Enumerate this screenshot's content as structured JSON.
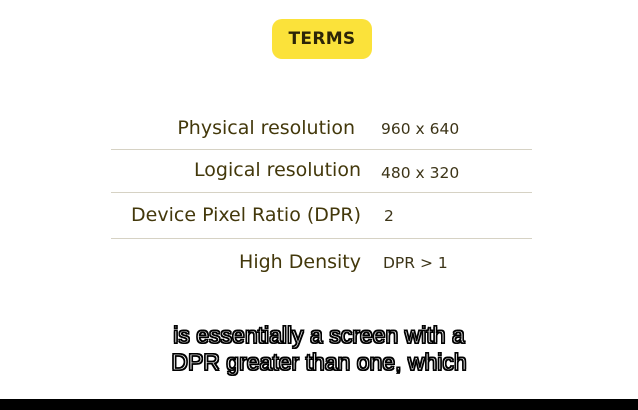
{
  "badge": {
    "label": "TERMS"
  },
  "terms": [
    {
      "term": "Physical resolution",
      "definition": "960 x 640"
    },
    {
      "term": "Logical resolution",
      "definition": "480 x 320"
    },
    {
      "term": "Device Pixel Ratio (DPR)",
      "definition": "2"
    },
    {
      "term": "High Density",
      "definition": "DPR > 1"
    }
  ],
  "caption": {
    "line1": "is essentially a screen with a",
    "line2": "DPR greater than one, which"
  },
  "colors": {
    "badge_bg": "#fbe23a",
    "term_text": "#43380b",
    "divider": "#d6d2c4"
  }
}
